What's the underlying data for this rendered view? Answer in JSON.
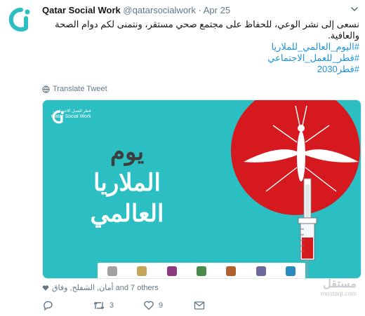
{
  "tweet": {
    "display_name": "Qatar Social Work",
    "handle": "@qatarsocialwork",
    "separator": "·",
    "date": "Apr 25",
    "text": "نسعى إلى نشر الوعي، للحفاظ على مجتمع صحي مستقر، ونتمنى لكم دوام الصحة والعافية.",
    "hashtags": [
      "#اليوم_العالمي_للملاريا",
      "#قطر_للعمل_الاجتماعي",
      "#قطر2030"
    ],
    "translate_label": "Translate Tweet",
    "likers_text": "أمان, الشفلح, وفاق and 7 others",
    "reply_count": "",
    "retweet_count": "3",
    "like_count": "9"
  },
  "media": {
    "brand_ar": "قطر للعمل الاجتماعي",
    "brand_en": "Qatar Social Work",
    "headline_1": "يوم",
    "headline_2": "الملاريا",
    "headline_3": "العالمي",
    "partner_logo_colors": [
      "#a0a0a0",
      "#c4a35a",
      "#8b3a7e",
      "#4a8a4a",
      "#b06030",
      "#6a6a9a",
      "#2a8ac0"
    ]
  },
  "watermark": {
    "main": "مستقل",
    "sub": "mostaql.com"
  },
  "colors": {
    "teal": "#2bbfc4",
    "red": "#d6181f",
    "link": "#1b95e0"
  }
}
